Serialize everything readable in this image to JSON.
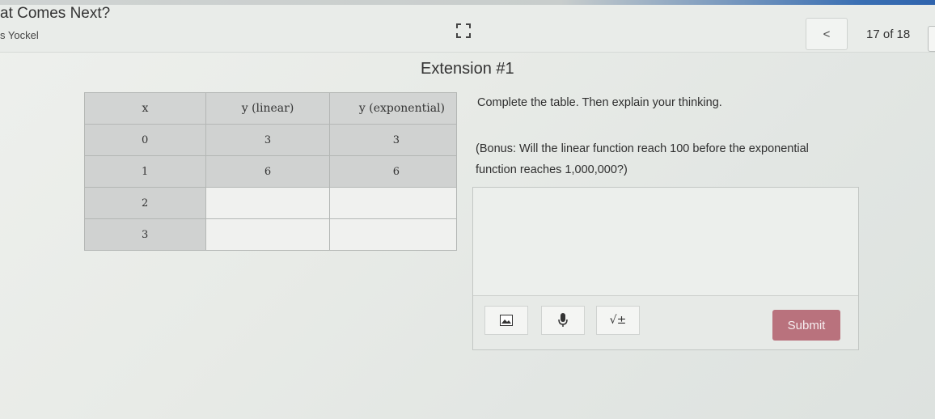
{
  "header": {
    "title": "at Comes Next?",
    "author": "s Yockel",
    "prev_label": "<",
    "page_count": "17 of 18"
  },
  "slide": {
    "title": "Extension #1",
    "prompt": "Complete the table. Then explain your thinking.",
    "bonus_line1": "(Bonus: Will the linear function reach 100 before the exponential",
    "bonus_line2": "function reaches 1,000,000?)"
  },
  "table": {
    "headers": [
      "x",
      "y (linear)",
      "y (exponential)"
    ],
    "rows": [
      [
        "0",
        "3",
        "3"
      ],
      [
        "1",
        "6",
        "6"
      ],
      [
        "2",
        "",
        ""
      ],
      [
        "3",
        "",
        ""
      ]
    ]
  },
  "toolbar": {
    "math_label": "√±",
    "submit_label": "Submit"
  },
  "colors": {
    "submit": "#b9727d",
    "accent_blue": "#2f64ad",
    "table_fill": "#d0d2d1"
  },
  "icons": [
    "expand-icon",
    "image-icon",
    "microphone-icon",
    "math-icon"
  ]
}
